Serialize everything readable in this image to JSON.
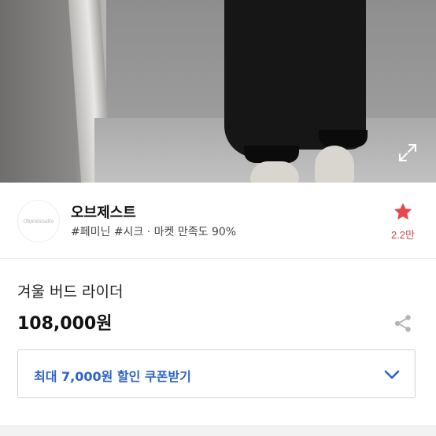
{
  "shop": {
    "name": "오브제스트",
    "meta": "#페미닌 #시크 · 마켓 만족도 90%",
    "logo_text": "Objeststudio",
    "favorite_count": "2.2만"
  },
  "product": {
    "title": "겨울 버드 라이더",
    "price": "108,000원"
  },
  "coupon": {
    "label": "최대 7,000원 할인 쿠폰받기"
  },
  "colors": {
    "accent_blue": "#2f63c8",
    "favorite_red": "#e5484d",
    "favorite_count": "#c9444b"
  },
  "icons": {
    "expand": "expand-icon",
    "star": "star-icon",
    "share": "share-icon",
    "chevron": "chevron-down-icon"
  }
}
